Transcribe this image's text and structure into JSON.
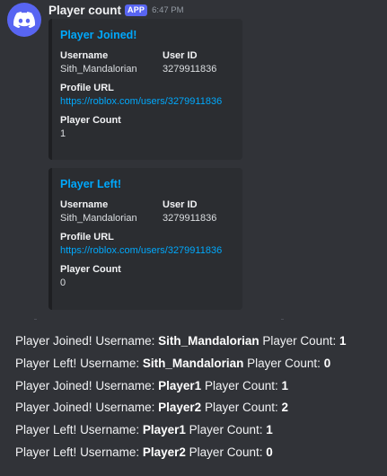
{
  "message": {
    "author": "Player count",
    "app_tag": "APP",
    "time": "6:47 PM",
    "avatar_icon": "discord-logo-icon"
  },
  "embeds": [
    {
      "title": "Player Joined!",
      "username_label": "Username",
      "username_value": "Sith_Mandalorian",
      "userid_label": "User ID",
      "userid_value": "3279911836",
      "profile_label": "Profile URL",
      "profile_value": "https://roblox.com/users/3279911836",
      "count_label": "Player Count",
      "count_value": "1"
    },
    {
      "title": "Player Left!",
      "username_label": "Username",
      "username_value": "Sith_Mandalorian",
      "userid_label": "User ID",
      "userid_value": "3279911836",
      "profile_label": "Profile URL",
      "profile_value": "https://roblox.com/users/3279911836",
      "count_label": "Player Count",
      "count_value": "0"
    }
  ],
  "log_lines": [
    {
      "event": "Player Joined!",
      "username_label": "Username:",
      "username": "Sith_Mandalorian",
      "count_label": "Player Count:",
      "count": "1"
    },
    {
      "event": "Player Left!",
      "username_label": "Username:",
      "username": "Sith_Mandalorian",
      "count_label": "Player Count:",
      "count": "0"
    },
    {
      "event": "Player Joined!",
      "username_label": "Username:",
      "username": "Player1",
      "count_label": "Player Count:",
      "count": "1"
    },
    {
      "event": "Player Joined!",
      "username_label": "Username:",
      "username": "Player2",
      "count_label": "Player Count:",
      "count": "2"
    },
    {
      "event": "Player Left!",
      "username_label": "Username:",
      "username": "Player1",
      "count_label": "Player Count:",
      "count": "1"
    },
    {
      "event": "Player Left!",
      "username_label": "Username:",
      "username": "Player2",
      "count_label": "Player Count:",
      "count": "0"
    }
  ],
  "colors": {
    "background": "#313338",
    "embed_bg": "#2b2d31",
    "accent": "#5865f2",
    "link": "#00a8fc"
  }
}
